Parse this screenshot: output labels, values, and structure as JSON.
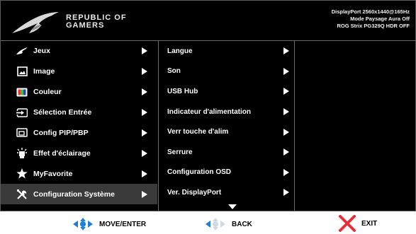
{
  "header": {
    "brand_line1": "REPUBLIC OF",
    "brand_line2": "GAMERS",
    "status": [
      "DisplayPort 2560x1440@165Hz",
      "Mode Paysage Aura Off",
      "ROG Strix PG329Q HDR OFF"
    ]
  },
  "main_menu": [
    {
      "label": "Jeux",
      "icon": "rog-eye-icon"
    },
    {
      "label": "Image",
      "icon": "image-icon"
    },
    {
      "label": "Couleur",
      "icon": "color-icon"
    },
    {
      "label": "Sélection Entrée",
      "icon": "input-icon"
    },
    {
      "label": "Config PIP/PBP",
      "icon": "pip-icon"
    },
    {
      "label": "Effet d'éclairage",
      "icon": "lighting-icon"
    },
    {
      "label": "MyFavorite",
      "icon": "star-icon"
    },
    {
      "label": "Configuration Système",
      "icon": "tools-icon",
      "active": true
    }
  ],
  "sub_menu": [
    "Langue",
    "Son",
    "USB Hub",
    "Indicateur d'alimentation",
    "Verr touche d'alim",
    "Serrure",
    "Configuration OSD",
    "Ver. DisplayPort"
  ],
  "footer": {
    "move_enter": "MOVE/ENTER",
    "back": "BACK",
    "exit": "EXIT"
  },
  "colors": {
    "accent_blue": "#1e7fd6",
    "exit_red": "#e5303a",
    "active_row": "#3a3a3a"
  }
}
